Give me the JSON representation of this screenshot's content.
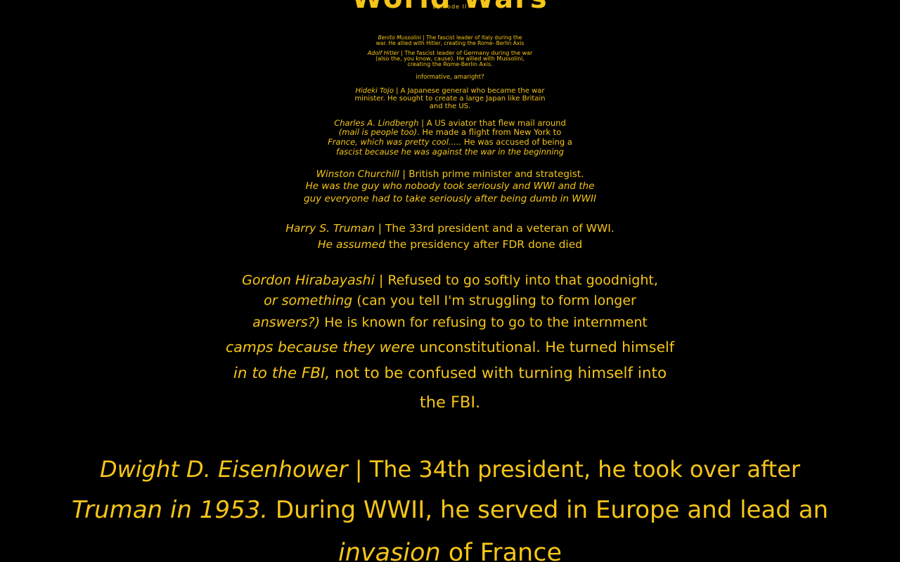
{
  "header": {
    "title": "World Wars",
    "episode": "Episode II"
  },
  "entries": [
    {
      "lines": [
        {
          "name": "Benito Mussolini",
          "text": " | The fascist leader of Italy during the"
        },
        {
          "text": "war.  He allied with Hitler, creating the Rome- Berlin Axis"
        }
      ]
    },
    {
      "lines": [
        {
          "name": "Adolf Hitler",
          "text": " | The fascist leader of Germany during the war"
        },
        {
          "text": "(also the, you know, cause).  He allied with Mussolini,"
        },
        {
          "text": "creating the Rome-Berlin Axis."
        }
      ]
    },
    {
      "lines": [
        {
          "text": "informative, amaright?"
        }
      ]
    },
    {
      "lines": [
        {
          "name": "Hideki Tojo",
          "text": " | A Japanese general who became the war"
        },
        {
          "text": "minister.  He sought to create a large Japan like Britain"
        },
        {
          "text": "and the US."
        }
      ]
    },
    {
      "lines": [
        {
          "name": "Charles A. Lindbergh",
          "text": " | A US aviator that flew mail around"
        },
        {
          "text": "(mail is people too).  He made a flight from New York to",
          "italic_prefix": "(mail is people too)."
        },
        {
          "text": "France, which was pretty cool.....  He was accused of being a",
          "italic_prefix": "France, which was pretty cool....."
        },
        {
          "text": "fascist because he was against the war in the beginning",
          "italic_prefix": "fascist because he was against the war in the beginning"
        }
      ]
    },
    {
      "lines": [
        {
          "name": "Winston Churchill",
          "text": " | British prime minister and strategist."
        },
        {
          "text": "He was the guy who nobody took seriously and WWI and the",
          "italic_prefix": "He was the guy who nobody took seriously and WWI and the"
        },
        {
          "text": "guy everyone had to take seriously after being dumb in WWII",
          "italic_prefix": "guy everyone had to take seriously after being dumb in WWII"
        }
      ]
    },
    {
      "lines": [
        {
          "name": "Harry S. Truman",
          "text": " | The 33rd president and a veteran of WWI."
        },
        {
          "text": "He assumed the presidency after FDR done died",
          "italic_prefix": "He assumed"
        }
      ]
    },
    {
      "lines": [
        {
          "name": "Gordon Hirabayashi",
          "text": " | Refused to go softly into that goodnight,"
        },
        {
          "text": "or something (can you tell I'm struggling to form longer",
          "italic_prefix": "or something"
        },
        {
          "text": "answers?)  He is known for refusing to go to the internment",
          "italic_prefix": "answers?)"
        },
        {
          "text": "camps because they were unconstitutional.  He turned himself",
          "italic_prefix": "camps because they were"
        },
        {
          "text": "in to the FBI, not to be confused with turning himself into",
          "italic_prefix": "in to the FBI,"
        },
        {
          "text": "the FBI."
        }
      ]
    },
    {
      "lines": [
        {
          "name": "Dwight D. Eisenhower",
          "text": " | The 34th president, he took over after"
        },
        {
          "text": "Truman in 1953.  During WWII, he served in Europe and lead an",
          "italic_prefix": "Truman in 1953."
        },
        {
          "text": "invasion of France",
          "italic_prefix": "invasion"
        }
      ]
    }
  ]
}
